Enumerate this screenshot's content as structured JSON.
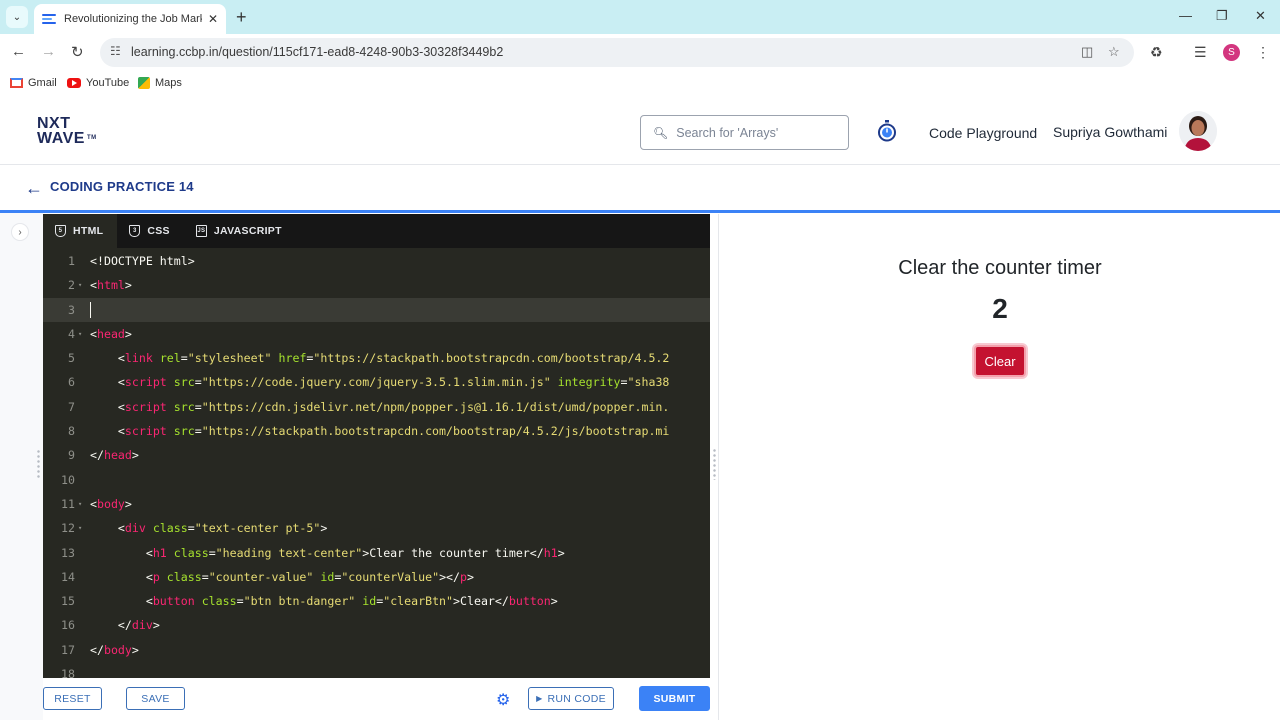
{
  "browser": {
    "tab_title": "Revolutionizing the Job Market",
    "url": "learning.ccbp.in/question/115cf171-ead8-4248-90b3-30328f3449b2",
    "profile_initial": "S",
    "bookmarks": [
      "Gmail",
      "YouTube",
      "Maps"
    ]
  },
  "header": {
    "logo_line1": "NXT",
    "logo_line2": "WAVE",
    "logo_tm": "TM",
    "search_placeholder": "Search for 'Arrays'",
    "code_playground": "Code Playground",
    "user_name": "Supriya Gowthami"
  },
  "practice": {
    "title": "CODING PRACTICE 14"
  },
  "editor": {
    "tabs": [
      "HTML",
      "CSS",
      "JAVASCRIPT"
    ],
    "active_tab": "HTML",
    "current_line": 3,
    "lines": [
      [
        [
          "t-pl",
          "<!DOCTYPE html>"
        ]
      ],
      [
        [
          "t-pl",
          "<"
        ],
        [
          "t-tag",
          "html"
        ],
        [
          "t-pl",
          ">"
        ]
      ],
      [],
      [
        [
          "t-pl",
          "<"
        ],
        [
          "t-tag",
          "head"
        ],
        [
          "t-pl",
          ">"
        ]
      ],
      [
        [
          "t-pl",
          "    <"
        ],
        [
          "t-tag",
          "link"
        ],
        [
          "t-pl",
          " "
        ],
        [
          "t-attr",
          "rel"
        ],
        [
          "t-pl",
          "="
        ],
        [
          "t-str",
          "\"stylesheet\""
        ],
        [
          "t-pl",
          " "
        ],
        [
          "t-attr",
          "href"
        ],
        [
          "t-pl",
          "="
        ],
        [
          "t-str",
          "\"https://stackpath.bootstrapcdn.com/bootstrap/4.5.2"
        ]
      ],
      [
        [
          "t-pl",
          "    <"
        ],
        [
          "t-tag",
          "script"
        ],
        [
          "t-pl",
          " "
        ],
        [
          "t-attr",
          "src"
        ],
        [
          "t-pl",
          "="
        ],
        [
          "t-str",
          "\"https://code.jquery.com/jquery-3.5.1.slim.min.js\""
        ],
        [
          "t-pl",
          " "
        ],
        [
          "t-attr",
          "integrity"
        ],
        [
          "t-pl",
          "="
        ],
        [
          "t-str",
          "\"sha38"
        ]
      ],
      [
        [
          "t-pl",
          "    <"
        ],
        [
          "t-tag",
          "script"
        ],
        [
          "t-pl",
          " "
        ],
        [
          "t-attr",
          "src"
        ],
        [
          "t-pl",
          "="
        ],
        [
          "t-str",
          "\"https://cdn.jsdelivr.net/npm/popper.js@1.16.1/dist/umd/popper.min."
        ]
      ],
      [
        [
          "t-pl",
          "    <"
        ],
        [
          "t-tag",
          "script"
        ],
        [
          "t-pl",
          " "
        ],
        [
          "t-attr",
          "src"
        ],
        [
          "t-pl",
          "="
        ],
        [
          "t-str",
          "\"https://stackpath.bootstrapcdn.com/bootstrap/4.5.2/js/bootstrap.mi"
        ]
      ],
      [
        [
          "t-pl",
          "</"
        ],
        [
          "t-tag",
          "head"
        ],
        [
          "t-pl",
          ">"
        ]
      ],
      [],
      [
        [
          "t-pl",
          "<"
        ],
        [
          "t-tag",
          "body"
        ],
        [
          "t-pl",
          ">"
        ]
      ],
      [
        [
          "t-pl",
          "    <"
        ],
        [
          "t-tag",
          "div"
        ],
        [
          "t-pl",
          " "
        ],
        [
          "t-attr",
          "class"
        ],
        [
          "t-pl",
          "="
        ],
        [
          "t-str",
          "\"text-center pt-5\""
        ],
        [
          "t-pl",
          ">"
        ]
      ],
      [
        [
          "t-pl",
          "        <"
        ],
        [
          "t-tag",
          "h1"
        ],
        [
          "t-pl",
          " "
        ],
        [
          "t-attr",
          "class"
        ],
        [
          "t-pl",
          "="
        ],
        [
          "t-str",
          "\"heading text-center\""
        ],
        [
          "t-pl",
          ">Clear the counter timer</"
        ],
        [
          "t-tag",
          "h1"
        ],
        [
          "t-pl",
          ">"
        ]
      ],
      [
        [
          "t-pl",
          "        <"
        ],
        [
          "t-tag",
          "p"
        ],
        [
          "t-pl",
          " "
        ],
        [
          "t-attr",
          "class"
        ],
        [
          "t-pl",
          "="
        ],
        [
          "t-str",
          "\"counter-value\""
        ],
        [
          "t-pl",
          " "
        ],
        [
          "t-attr",
          "id"
        ],
        [
          "t-pl",
          "="
        ],
        [
          "t-str",
          "\"counterValue\""
        ],
        [
          "t-pl",
          "></"
        ],
        [
          "t-tag",
          "p"
        ],
        [
          "t-pl",
          ">"
        ]
      ],
      [
        [
          "t-pl",
          "        <"
        ],
        [
          "t-tag",
          "button"
        ],
        [
          "t-pl",
          " "
        ],
        [
          "t-attr",
          "class"
        ],
        [
          "t-pl",
          "="
        ],
        [
          "t-str",
          "\"btn btn-danger\""
        ],
        [
          "t-pl",
          " "
        ],
        [
          "t-attr",
          "id"
        ],
        [
          "t-pl",
          "="
        ],
        [
          "t-str",
          "\"clearBtn\""
        ],
        [
          "t-pl",
          ">Clear</"
        ],
        [
          "t-tag",
          "button"
        ],
        [
          "t-pl",
          ">"
        ]
      ],
      [
        [
          "t-pl",
          "    </"
        ],
        [
          "t-tag",
          "div"
        ],
        [
          "t-pl",
          ">"
        ]
      ],
      [
        [
          "t-pl",
          "</"
        ],
        [
          "t-tag",
          "body"
        ],
        [
          "t-pl",
          ">"
        ]
      ],
      []
    ],
    "foldable_lines": [
      2,
      4,
      11,
      12
    ]
  },
  "preview": {
    "heading": "Clear the counter timer",
    "counter_value": "2",
    "clear_button": "Clear"
  },
  "footer": {
    "reset": "RESET",
    "save": "SAVE",
    "run_code": "RUN CODE",
    "submit": "SUBMIT"
  },
  "colors": {
    "accent": "#3b82f6",
    "brand_navy": "#1e3a8a",
    "danger": "#c41230",
    "editor_bg": "#272822"
  }
}
